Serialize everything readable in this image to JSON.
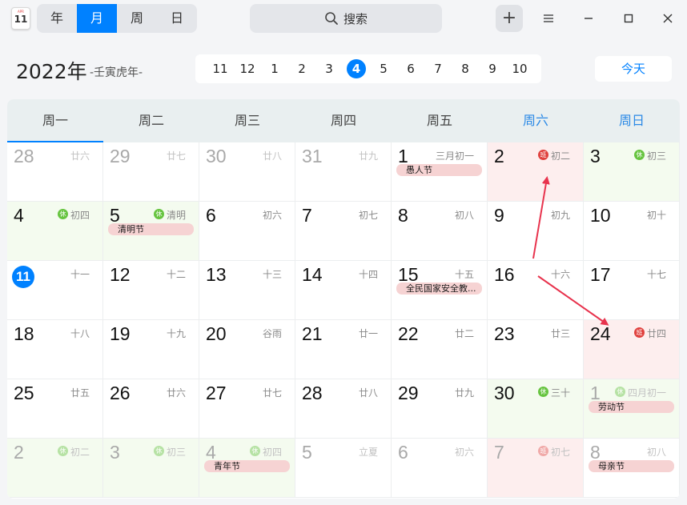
{
  "app": {
    "icon_month": "APR",
    "icon_day": "11"
  },
  "view_switch": {
    "year": "年",
    "month": "月",
    "week": "周",
    "day": "日",
    "active": "month"
  },
  "search": {
    "label": "搜索"
  },
  "toolbar": {
    "add_label": "+"
  },
  "header": {
    "year": "2022年",
    "lunar_year": "-壬寅虎年-",
    "months": [
      "11",
      "12",
      "1",
      "2",
      "3",
      "4",
      "5",
      "6",
      "7",
      "8",
      "9",
      "10"
    ],
    "active_month": "4",
    "today_label": "今天"
  },
  "weekdays": [
    "周一",
    "周二",
    "周三",
    "周四",
    "周五",
    "周六",
    "周日"
  ],
  "weeks": [
    [
      {
        "day": "28",
        "lunar": "廿六",
        "dim": true
      },
      {
        "day": "29",
        "lunar": "廿七",
        "dim": true
      },
      {
        "day": "30",
        "lunar": "廿八",
        "dim": true
      },
      {
        "day": "31",
        "lunar": "廿九",
        "dim": true
      },
      {
        "day": "1",
        "lunar": "三月初一",
        "event": "愚人节"
      },
      {
        "day": "2",
        "lunar": "初二",
        "badge": "班",
        "badge_type": "work",
        "bg": "work"
      },
      {
        "day": "3",
        "lunar": "初三",
        "badge": "休",
        "badge_type": "rest",
        "bg": "weekend"
      }
    ],
    [
      {
        "day": "4",
        "lunar": "初四",
        "badge": "休",
        "badge_type": "rest",
        "bg": "weekend"
      },
      {
        "day": "5",
        "lunar": "清明",
        "badge": "休",
        "badge_type": "rest",
        "bg": "weekend",
        "event": "清明节"
      },
      {
        "day": "6",
        "lunar": "初六"
      },
      {
        "day": "7",
        "lunar": "初七"
      },
      {
        "day": "8",
        "lunar": "初八"
      },
      {
        "day": "9",
        "lunar": "初九"
      },
      {
        "day": "10",
        "lunar": "初十"
      }
    ],
    [
      {
        "day": "11",
        "lunar": "十一",
        "today": true
      },
      {
        "day": "12",
        "lunar": "十二"
      },
      {
        "day": "13",
        "lunar": "十三"
      },
      {
        "day": "14",
        "lunar": "十四"
      },
      {
        "day": "15",
        "lunar": "十五",
        "event": "全民国家安全教..."
      },
      {
        "day": "16",
        "lunar": "十六"
      },
      {
        "day": "17",
        "lunar": "十七"
      }
    ],
    [
      {
        "day": "18",
        "lunar": "十八"
      },
      {
        "day": "19",
        "lunar": "十九"
      },
      {
        "day": "20",
        "lunar": "谷雨"
      },
      {
        "day": "21",
        "lunar": "廿一"
      },
      {
        "day": "22",
        "lunar": "廿二"
      },
      {
        "day": "23",
        "lunar": "廿三"
      },
      {
        "day": "24",
        "lunar": "廿四",
        "badge": "班",
        "badge_type": "work",
        "bg": "work"
      }
    ],
    [
      {
        "day": "25",
        "lunar": "廿五"
      },
      {
        "day": "26",
        "lunar": "廿六"
      },
      {
        "day": "27",
        "lunar": "廿七"
      },
      {
        "day": "28",
        "lunar": "廿八"
      },
      {
        "day": "29",
        "lunar": "廿九"
      },
      {
        "day": "30",
        "lunar": "三十",
        "badge": "休",
        "badge_type": "rest",
        "bg": "weekend"
      },
      {
        "day": "1",
        "lunar": "四月初一",
        "badge": "休",
        "badge_type": "rest",
        "bg": "weekend",
        "dim": true,
        "event": "劳动节"
      }
    ],
    [
      {
        "day": "2",
        "lunar": "初二",
        "badge": "休",
        "badge_type": "rest",
        "bg": "weekend",
        "dim": true
      },
      {
        "day": "3",
        "lunar": "初三",
        "badge": "休",
        "badge_type": "rest",
        "bg": "weekend",
        "dim": true
      },
      {
        "day": "4",
        "lunar": "初四",
        "badge": "休",
        "badge_type": "rest",
        "bg": "weekend",
        "dim": true,
        "event": "青年节"
      },
      {
        "day": "5",
        "lunar": "立夏",
        "dim": true
      },
      {
        "day": "6",
        "lunar": "初六",
        "dim": true
      },
      {
        "day": "7",
        "lunar": "初七",
        "badge": "班",
        "badge_type": "work",
        "bg": "work",
        "dim": true
      },
      {
        "day": "8",
        "lunar": "初八",
        "dim": true,
        "event": "母亲节"
      }
    ]
  ],
  "colors": {
    "accent": "#0081ff",
    "rest_badge": "#66c43f",
    "work_badge": "#e0413e",
    "annotation_arrow": "#e8334d"
  }
}
